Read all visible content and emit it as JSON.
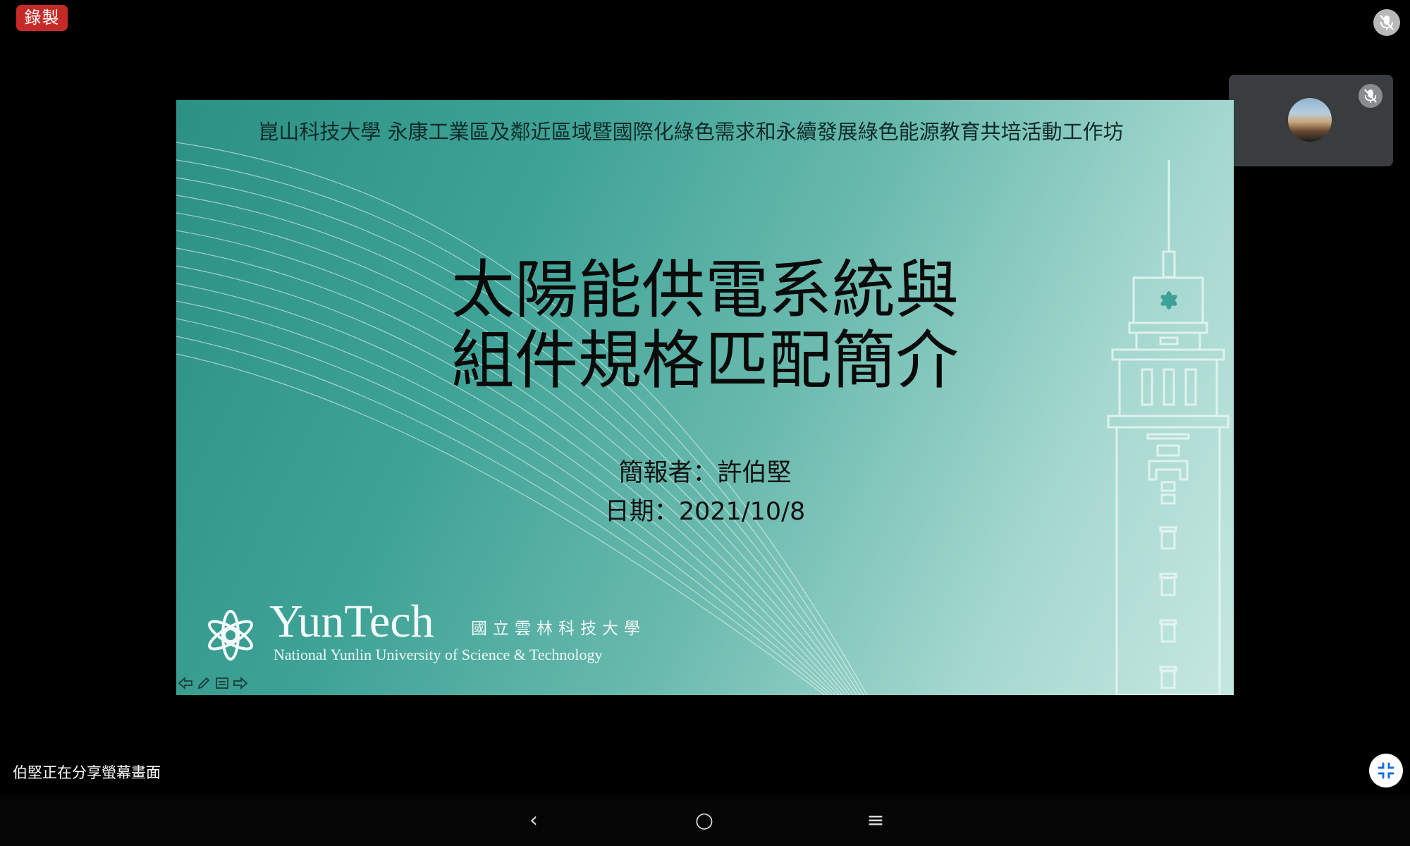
{
  "recording_badge": "錄製",
  "slide": {
    "header": "崑山科技大學 永康工業區及鄰近區域暨國際化綠色需求和永續發展綠色能源教育共培活動工作坊",
    "title_line1": "太陽能供電系統與",
    "title_line2": "組件規格匹配簡介",
    "presenter": "簡報者：許伯堅",
    "date": "日期：2021/10/8",
    "logo": {
      "main": "YunTech",
      "chinese": "國立雲林科技大學",
      "english": "National Yunlin University of Science & Technology"
    },
    "nav_icons": [
      "arrow-left-icon",
      "pen-icon",
      "menu-icon",
      "arrow-right-icon"
    ]
  },
  "share_status": "伯堅正在分享螢幕畫面",
  "android_nav": {
    "back": "‹",
    "home": "○",
    "recents": "≡"
  },
  "colors": {
    "record_red": "#c62a27",
    "slide_teal": "#3ea296"
  }
}
